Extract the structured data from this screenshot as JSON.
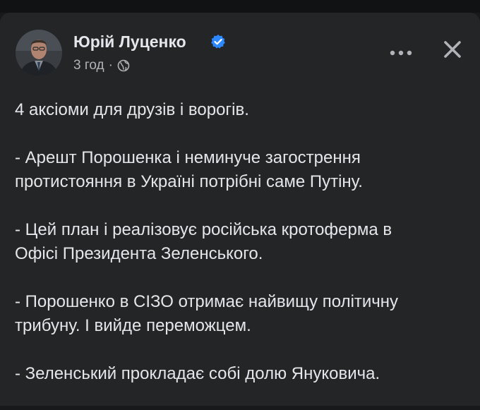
{
  "colors": {
    "background": "#18191a",
    "card": "#242526",
    "primary_text": "#e4e6eb",
    "secondary_text": "#b0b3b8",
    "verified_blue": "#2d88ff"
  },
  "post": {
    "author": {
      "name": "Юрій Луценко",
      "verified_icon": "verified-badge-icon",
      "avatar_icon": "profile-photo"
    },
    "meta": {
      "time": "3 год",
      "separator": "·",
      "audience_icon": "globe-icon"
    },
    "actions": {
      "more_icon": "more-options-icon",
      "close_icon": "close-icon"
    },
    "paragraphs": [
      {
        "lines": [
          "4 аксіоми для друзів і ворогів."
        ]
      },
      {
        "lines": [
          "- Арешт Порошенка і неминуче загострення",
          "протистояння в Україні потрібні саме Путіну."
        ]
      },
      {
        "lines": [
          "- Цей план і реалізовує російська кротоферма в",
          "Офісі Президента Зеленського."
        ]
      },
      {
        "lines": [
          "- Порошенко в СІЗО отримає найвищу політичну",
          "трибуну. І вийде переможцем."
        ]
      },
      {
        "lines": [
          "- Зеленський прокладає собі долю Януковича."
        ]
      }
    ]
  }
}
